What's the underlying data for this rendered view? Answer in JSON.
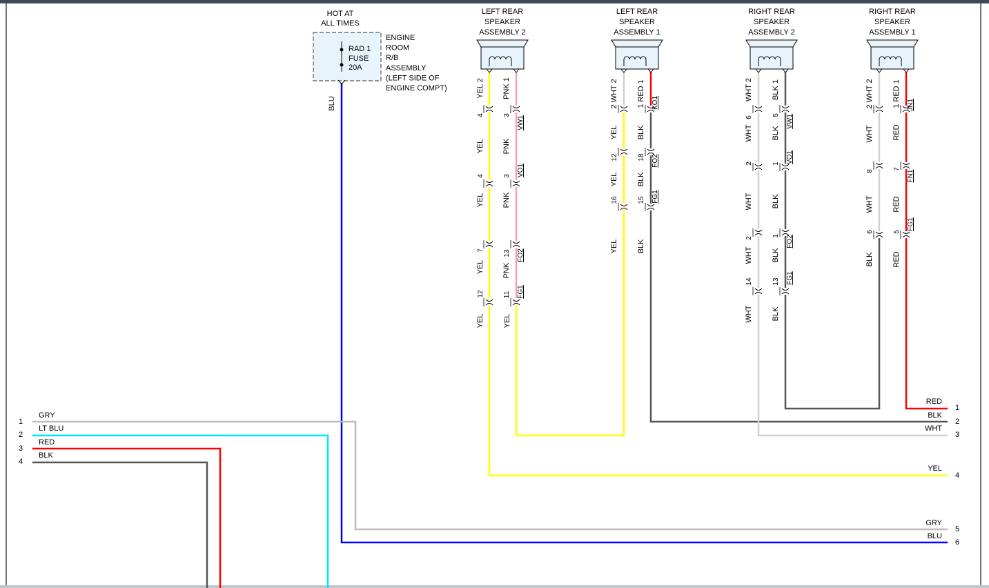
{
  "colors": {
    "yellow": "#ffff00",
    "pink": "#f4a0b8",
    "red": "#ff0000",
    "black": "#555555",
    "white": "#d0d0d0",
    "blue": "#0000ff",
    "lt_blue": "#00e5ff",
    "gray": "#bbbbbb",
    "box_fill": "#e8f4fc"
  },
  "fuse": {
    "header_line1": "HOT AT",
    "header_line2": "ALL TIMES",
    "label_line1": "RAD 1",
    "label_line2": "FUSE",
    "label_line3": "20A",
    "assembly_lines": [
      "ENGINE",
      "ROOM",
      "R/B",
      "ASSEMBLY",
      "(LEFT SIDE OF",
      "ENGINE COMPT)"
    ],
    "wire_color": "BLU"
  },
  "speakers": [
    {
      "name_lines": [
        "LEFT REAR",
        "SPEAKER",
        "ASSEMBLY 2"
      ],
      "top_labels": [
        "YEL 2",
        "PNK 1"
      ],
      "wires": [
        {
          "top": "YEL 2",
          "pins": [
            "4",
            "4",
            "7",
            "12"
          ],
          "colors": [
            "YEL",
            "YEL",
            "YEL",
            "YEL"
          ]
        },
        {
          "top": "PNK 1",
          "pins": [
            "3",
            "3",
            "13",
            "11"
          ],
          "colors": [
            "PNK",
            "PNK",
            "PNK",
            "YEL"
          ]
        }
      ],
      "connectors": [
        "VW1",
        "VO1",
        "FO2",
        "FG1"
      ]
    },
    {
      "name_lines": [
        "LEFT REAR",
        "SPEAKER",
        "ASSEMBLY 1"
      ],
      "top_labels": [
        "2 WHT 2",
        "1 RED 1"
      ],
      "wires": [
        {
          "pins": [
            "12",
            "16"
          ],
          "colors": [
            "YEL",
            "YEL",
            "YEL"
          ]
        },
        {
          "pins": [
            "18",
            "15"
          ],
          "colors": [
            "BLK",
            "BLK",
            "BLK"
          ]
        }
      ],
      "connectors": [
        "KO1",
        "FO2",
        "FG1"
      ]
    },
    {
      "name_lines": [
        "RIGHT REAR",
        "SPEAKER",
        "ASSEMBLY 2"
      ],
      "top_labels": [
        "WHT 2",
        "BLK 1"
      ],
      "wires": [
        {
          "pins": [
            "6",
            "2",
            "2",
            "14"
          ],
          "colors": [
            "WHT",
            "WHT",
            "WHT",
            "WHT"
          ]
        },
        {
          "pins": [
            "5",
            "1",
            "1",
            "13"
          ],
          "colors": [
            "BLK",
            "BLK",
            "BLK",
            "BLK"
          ]
        }
      ],
      "connectors": [
        "VW1",
        "VO1",
        "FO2",
        "FG1"
      ]
    },
    {
      "name_lines": [
        "RIGHT REAR",
        "SPEAKER",
        "ASSEMBLY 1"
      ],
      "top_labels": [
        "2 WHT 2",
        "1 RED 1"
      ],
      "wires": [
        {
          "pins": [
            "8",
            "6"
          ],
          "colors": [
            "WHT",
            "WHT",
            "BLK"
          ]
        },
        {
          "pins": [
            "7",
            "5"
          ],
          "colors": [
            "RED",
            "RED",
            "RED"
          ]
        }
      ],
      "connectors": [
        "JN1",
        "FN1",
        "FG1"
      ]
    }
  ],
  "right_connector": {
    "pins": [
      {
        "num": "1",
        "color": "RED"
      },
      {
        "num": "2",
        "color": "BLK"
      },
      {
        "num": "3",
        "color": "WHT"
      },
      {
        "num": "4",
        "color": "YEL"
      },
      {
        "num": "5",
        "color": "GRY"
      },
      {
        "num": "6",
        "color": "BLU"
      }
    ]
  },
  "left_connector": {
    "pins": [
      {
        "num": "1",
        "color": "GRY"
      },
      {
        "num": "2",
        "color": "LT BLU"
      },
      {
        "num": "3",
        "color": "RED"
      },
      {
        "num": "4",
        "color": "BLK"
      }
    ]
  }
}
